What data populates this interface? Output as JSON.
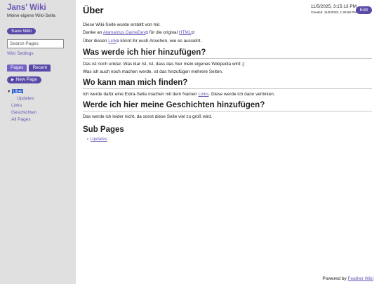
{
  "sidebar": {
    "wiki_title": "Jans' Wiki",
    "wiki_description": "Meine eigene Wiki-Seite.",
    "save_label": "Save Wiki",
    "search_placeholder": "Search Pages",
    "settings_label": "Wiki Settings",
    "tabs": [
      {
        "label": "Pages",
        "active": true
      },
      {
        "label": "Recent",
        "active": false
      }
    ],
    "new_page_label": "New Page",
    "tree": {
      "current": "Über",
      "child": "Updates",
      "items": [
        "Links",
        "Geschichten",
        "All Pages"
      ]
    }
  },
  "page": {
    "title": "Über",
    "modified": "11/5/2025, 3:15:13 PM",
    "created": "Created: 11/5/2025, 1:26:58 PM",
    "edit_label": "Edit",
    "intro": {
      "line1": "Diese Wiki-Seite wurde erstellt von mir.",
      "line2_pre": "Danke an ",
      "link_alamantus": "Alamantus GameDev",
      "line2_mid": " für die original ",
      "link_html": "HTML",
      "line2_post": "!",
      "line3_pre": "Über diesen ",
      "link_link": "Link",
      "line3_post": " könnt ihr euch Ansehen, wie es aussieht."
    },
    "sections": [
      {
        "heading": "Was werde ich hier hinzufügen?",
        "lines": [
          "Das ist noch unklar. Was klar ist, ist, dass das hier mein eigenes Wikipedia wird ;)",
          "Was ich auch noch machen werde, ist das hinzufügen mehrere Seiten."
        ]
      },
      {
        "heading": "Wo kann man mich finden?",
        "line_pre": "Ich werde dafür eine Extra-Seite machen mit dem Namen ",
        "link": "Links",
        "line_post": ". Diese werde ich dann verlinken."
      },
      {
        "heading": "Werde ich hier meine Geschichten hinzufügen?",
        "lines": [
          "Das werde ich leider nicht, da sonst diese Seite viel zu groß wird."
        ]
      }
    ],
    "subpages_heading": "Sub Pages",
    "subpages": [
      "Updates"
    ]
  },
  "footer": {
    "prefix": "Powered by ",
    "link": "Feather Wiki"
  },
  "colors": {
    "accent": "#6b55b7",
    "button": "#5a4aa8",
    "sidebar_bg": "#e0e0e0",
    "selected": "#2b58c7"
  },
  "icons": {
    "external_link": "external-link-icon",
    "new_page": "triangle-right-icon",
    "tree_caret": "caret-down-icon"
  }
}
